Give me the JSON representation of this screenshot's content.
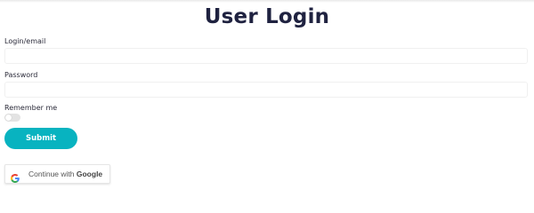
{
  "page": {
    "title": "User Login"
  },
  "form": {
    "login_label": "Login/email",
    "login_value": "",
    "password_label": "Password",
    "password_value": "",
    "remember_label": "Remember me",
    "remember_checked": false,
    "submit_label": "Submit"
  },
  "google": {
    "prefix": "Continue with ",
    "brand": "Google",
    "icon": "google-g-icon"
  },
  "colors": {
    "title": "#1f2240",
    "accent": "#08b3c0"
  }
}
